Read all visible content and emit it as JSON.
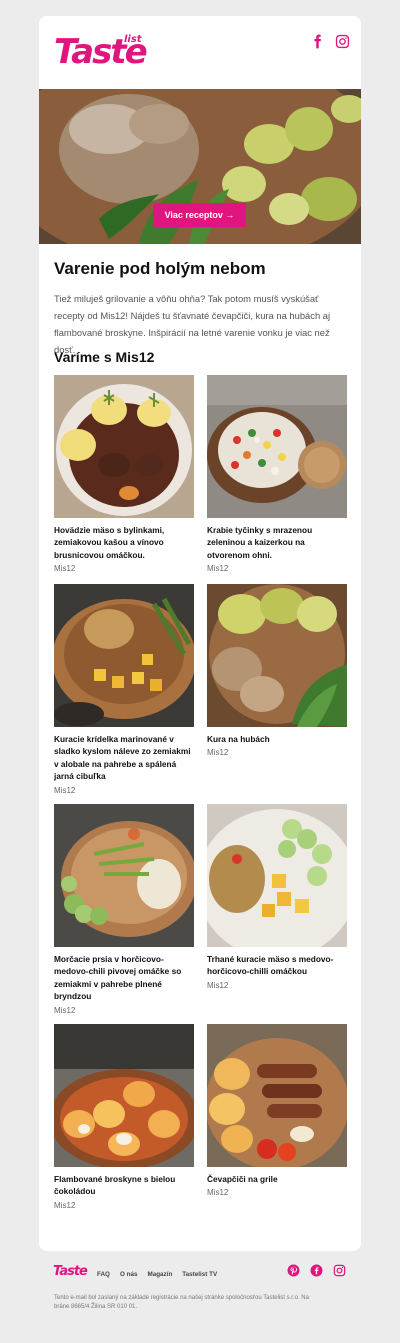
{
  "brand": {
    "logo_main": "Taste",
    "logo_sup": "list",
    "accent": "#e0157d"
  },
  "header": {
    "social": [
      "facebook-icon",
      "instagram-icon"
    ]
  },
  "hero": {
    "button_label": "Viac receptov →"
  },
  "article": {
    "title": "Varenie pod holým nebom",
    "intro": "Tiež miluješ grilovanie a vôňu ohňa? Tak potom musíš vyskúšať recepty od Mis12! Nájdeš tu šťavnaté čevapčiči, kura na hubách aj flambované broskyne. Inšpirácií na letné varenie vonku je viac než dosť.",
    "section_title": "Varíme s Mis12"
  },
  "recipes": [
    {
      "name": "Hovädzie mäso s bylinkami, zemiakovou kašou a vínovo brusnicovou omáčkou.",
      "source": "Mis12"
    },
    {
      "name": "Krabie tyčinky s mrazenou zeleninou a kaizerkou na otvorenom ohni.",
      "source": "Mis12"
    },
    {
      "name": "Kuracie krídelka marinované v sladko kyslom náleve zo zemiakmi v alobale na pahrebe a spálená jarná cibuľka",
      "source": "Mis12"
    },
    {
      "name": "Kura na hubách",
      "source": "Mis12"
    },
    {
      "name": "Morčacie prsia v horčicovo-medovo-chili pivovej omáčke so zemiakmi v pahrebe plnené bryndzou",
      "source": "Mis12"
    },
    {
      "name": "Trhané kuracie mäso s medovo-horčicovo-chilli omáčkou",
      "source": "Mis12"
    },
    {
      "name": "Flambované broskyne s bielou čokoládou",
      "source": "Mis12"
    },
    {
      "name": "Čevapčiči na grile",
      "source": "Mis12"
    }
  ],
  "footer": {
    "logo": "Taste",
    "nav": [
      "FAQ",
      "O nás",
      "Magazín",
      "Tastelist TV"
    ],
    "social": [
      "pinterest-icon",
      "facebook-icon",
      "instagram-icon"
    ],
    "legal": "Tento e-mail bol zaslaný na základe registrácie na našej stránke spoločnosťou Tastelist s.r.o. Na bráne 8665/4 Žilina SR 010 01."
  }
}
